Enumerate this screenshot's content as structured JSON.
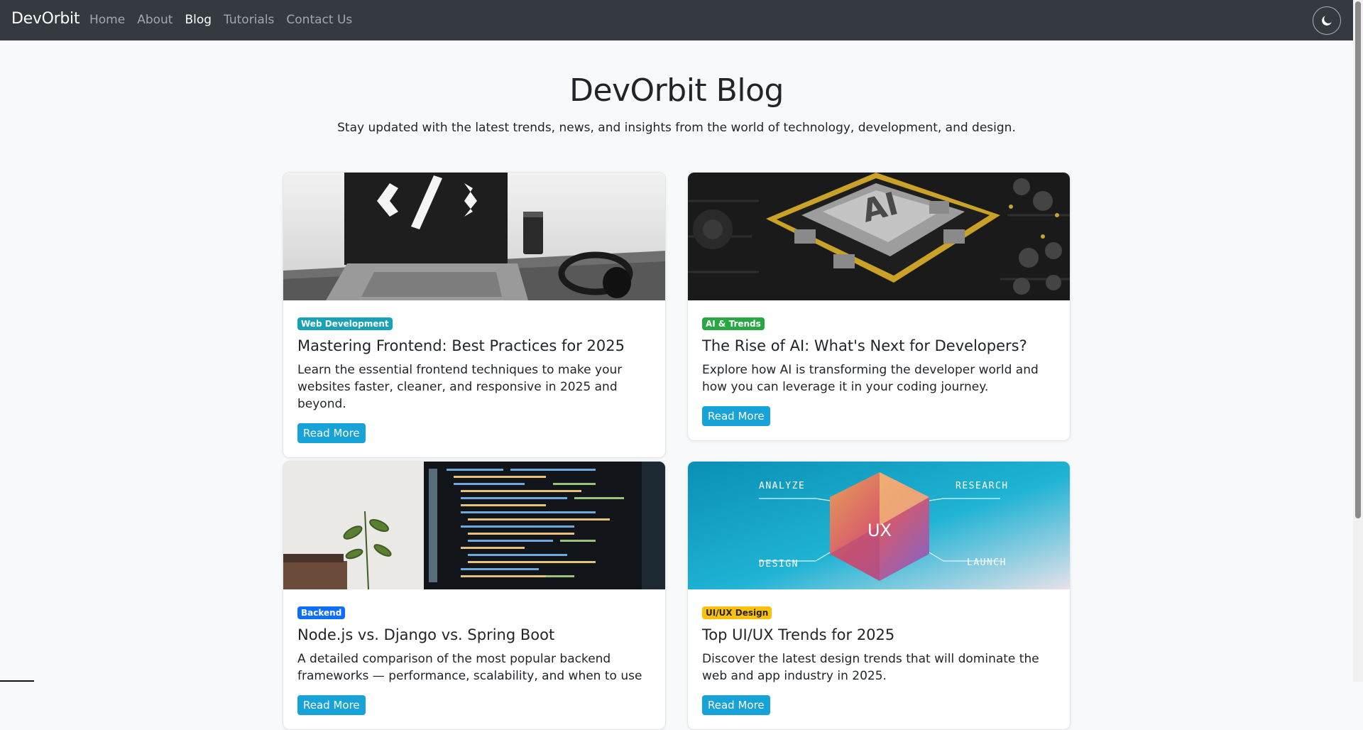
{
  "navbar": {
    "brand": "DevOrbit",
    "links": [
      "Home",
      "About",
      "Blog",
      "Tutorials",
      "Contact Us"
    ],
    "active_link": "Blog",
    "theme_toggle_icon": "moon-icon",
    "bg_color": "#343a40"
  },
  "hero": {
    "title": "DevOrbit Blog",
    "subtitle": "Stay updated with the latest trends, news, and insights from the world of technology, development, and design."
  },
  "posts": [
    {
      "badge": "Web Development",
      "badge_color": "#17a2b8",
      "title": "Mastering Frontend: Best Practices for 2025",
      "excerpt": "Learn the essential frontend techniques to make your websites faster, cleaner, and responsive in 2025 and beyond.",
      "button": "Read More",
      "image_icon": "code-laptop-icon"
    },
    {
      "badge": "AI & Trends",
      "badge_color": "#28a745",
      "title": "The Rise of AI: What's Next for Developers?",
      "excerpt": "Explore how AI is transforming the developer world and how you can leverage it in your coding journey.",
      "button": "Read More",
      "image_icon": "ai-chip-icon"
    },
    {
      "badge": "Backend",
      "badge_color": "#0d6efd",
      "title": "Node.js vs. Django vs. Spring Boot",
      "excerpt": "A detailed comparison of the most popular backend frameworks — performance, scalability, and when to use",
      "button": "Read More",
      "image_icon": "code-screen-icon"
    },
    {
      "badge": "UI/UX Design",
      "badge_color": "#ffc107",
      "title": "Top UI/UX Trends for 2025",
      "excerpt": "Discover the latest design trends that will dominate the web and app industry in 2025.",
      "button": "Read More",
      "image_icon": "ux-diagram-icon",
      "image_labels": {
        "analyze": "ANALYZE",
        "research": "RESEARCH",
        "design": "DESIGN",
        "launch": "LAUNCH",
        "center": "UX"
      }
    }
  ]
}
